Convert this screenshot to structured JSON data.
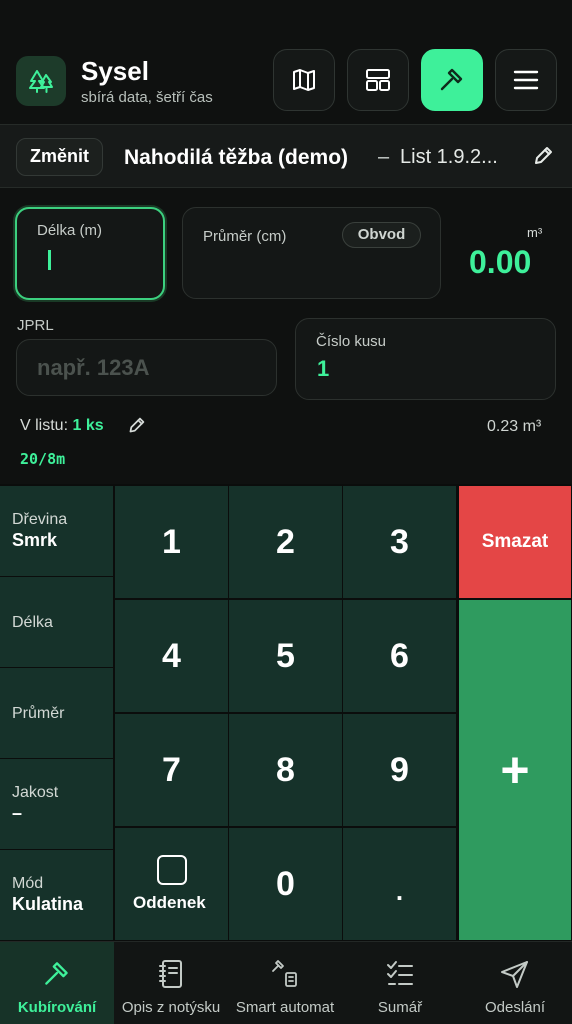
{
  "app": {
    "title": "Sysel",
    "subtitle": "sbírá data, šetří čas"
  },
  "header_buttons": [
    {
      "icon": "map-icon"
    },
    {
      "icon": "layout-icon"
    },
    {
      "icon": "hammer-icon",
      "active": true
    },
    {
      "icon": "menu-icon"
    }
  ],
  "sheet": {
    "change_label": "Změnit",
    "title": "Nahodilá těžba (demo)",
    "separator": "–",
    "list": "List 1.9.2..."
  },
  "form": {
    "length_label": "Délka (m)",
    "diameter_label": "Průměr (cm)",
    "circumference_toggle": "Obvod",
    "volume_unit": "m³",
    "volume_value": "0.00",
    "jprl_label": "JPRL",
    "jprl_placeholder": "např. 123A",
    "piece_label": "Číslo kusu",
    "piece_value": "1"
  },
  "summary": {
    "in_sheet_label": "V listu:",
    "in_sheet_count": "1 ks",
    "in_sheet_total": "0.23 m³",
    "ratio": "20/8m"
  },
  "side_panel": [
    {
      "label": "Dřevina",
      "value": "Smrk"
    },
    {
      "label": "Délka",
      "value": ""
    },
    {
      "label": "Průměr",
      "value": ""
    },
    {
      "label": "Jakost",
      "value": "–"
    },
    {
      "label": "Mód",
      "value": "Kulatina"
    }
  ],
  "keys": {
    "k1": "1",
    "k2": "2",
    "k3": "3",
    "k4": "4",
    "k5": "5",
    "k6": "6",
    "k7": "7",
    "k8": "8",
    "k9": "9",
    "k0": "0",
    "dot": ".",
    "oddenek": "Oddenek",
    "delete": "Smazat",
    "plus": "+"
  },
  "tabs": [
    {
      "label": "Kubírování",
      "icon": "hammer-icon",
      "active": true
    },
    {
      "label": "Opis z notýsku",
      "icon": "notebook-icon"
    },
    {
      "label": "Smart automat",
      "icon": "smart-automat-icon"
    },
    {
      "label": "Sumář",
      "icon": "checklist-icon"
    },
    {
      "label": "Odeslání",
      "icon": "send-icon"
    }
  ],
  "colors": {
    "accent": "#3ef09a",
    "delete": "#e44646",
    "plus": "#2f9b5f",
    "keypad": "#16322a"
  }
}
